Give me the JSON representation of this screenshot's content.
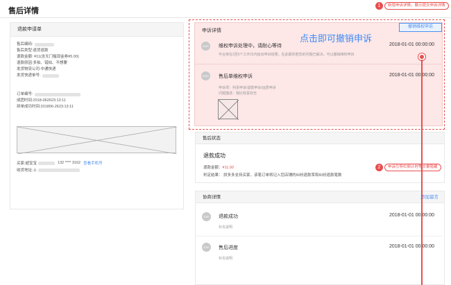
{
  "page": {
    "title": "售后详情"
  },
  "annotations": {
    "note1": {
      "num": "1",
      "text": "新增申诉详情，展示提交申诉详情"
    },
    "note2": {
      "num": "2",
      "text": "申诉引导栏倒计时等文案隐藏"
    },
    "callout": "点击即可撤销申诉"
  },
  "refund_form": {
    "title": "退款申请单",
    "lines": [
      "售后编码:",
      "售后类型:退货退款",
      "退款金额: ¥11(含无门槛现金券¥5.00)",
      "退款原因:多拍、错拍、不想要",
      "发货物流公司:中通快递",
      "发货快递单号:"
    ],
    "order_lines": [
      "订单编号:",
      "成团时间:2018-062623:13:11",
      "拼单成功时间:201806-2623:13:11"
    ],
    "buyer_label": "买家:超宝宝",
    "buyer_phone": "132 **** 3162",
    "view_phone": "查看手机号",
    "address_label": "收货地址:上"
  },
  "appeal": {
    "title": "申诉详情",
    "revoke_button": "撤销维权申诉",
    "items": [
      {
        "avatar": "icon",
        "title": "维权申诉处理中，请耐心等待",
        "date": "2018-01-01 00:00:00",
        "sub": "平台将在3至5个工作日内给出申诉结果，在此期间若您的问题已解决，可以撤销维权申诉"
      },
      {
        "avatar": "icon",
        "title": "售后单维权申诉",
        "date": "2018-01-01 00:00:00",
        "sub1": "申诉项：判责申诉/退款申诉/运费申诉",
        "sub2": "问题描述：我比较喜欢无"
      }
    ]
  },
  "status": {
    "title": "售后状态",
    "result": "退款成功",
    "amount_label": "退款金额：",
    "amount": "¥11.00",
    "verdict": "判定结果：  拼多多支持买家，该笔订单将记入您店铺的纠纷退款率和纠纷退款笔数"
  },
  "negotiation": {
    "title": "协商详情",
    "add_message": "添加留言",
    "items": [
      {
        "avatar": "icon",
        "title": "退款成功",
        "date": "2018-01-01 00:00:00",
        "sub": "补充说明"
      },
      {
        "avatar": "icon",
        "title": "售后进度",
        "date": "2018-01-01 00:00:00",
        "sub": "补充说明"
      }
    ]
  }
}
